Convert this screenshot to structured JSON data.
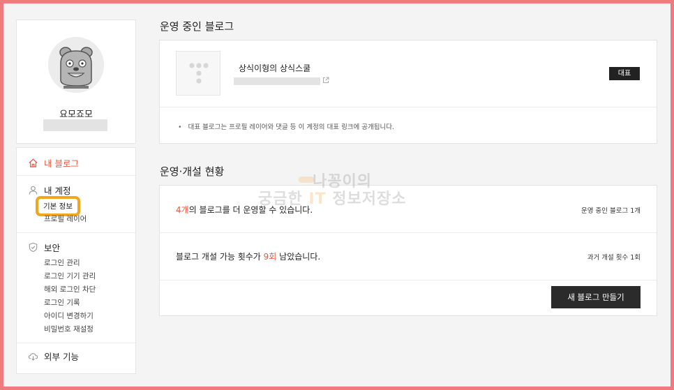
{
  "profile": {
    "name": "요모죠모"
  },
  "sidebar": {
    "my_blog": "내 블로그",
    "my_account": {
      "title": "내 계정",
      "items": [
        "기본 정보",
        "프로필 레이어"
      ]
    },
    "security": {
      "title": "보안",
      "items": [
        "로그인 관리",
        "로그인 기기 관리",
        "해외 로그인 차단",
        "로그인 기록",
        "아이디 변경하기",
        "비밀번호 재설정"
      ]
    },
    "external": "외부 기능"
  },
  "operating_blogs": {
    "title": "운영 중인 블로그",
    "blog_name": "상식이형의 상식스쿨",
    "badge": "대표",
    "note": "대표 블로그는 프로필 레이어와 댓글 등 이 계정의 대표 링크에 공개됩니다."
  },
  "status": {
    "title": "운영·개설 현황",
    "row1": {
      "count": "4개",
      "text": "의 블로그를 더 운영할 수 있습니다.",
      "right": "운영 중인 블로그 1개"
    },
    "row2": {
      "prefix": "블로그 개설 가능 횟수가 ",
      "count": "9회",
      "suffix": " 남았습니다.",
      "right": "과거 개설 횟수 1회"
    },
    "cta": "새 블로그 만들기"
  },
  "watermark": {
    "line1": "나꽁이의",
    "line2_a": "궁금한 ",
    "line2_it": "IT",
    "line2_b": " 정보저장소"
  },
  "colors": {
    "accent": "#e8573f",
    "frame": "#ef7b7f",
    "highlight": "#f2a61b"
  }
}
